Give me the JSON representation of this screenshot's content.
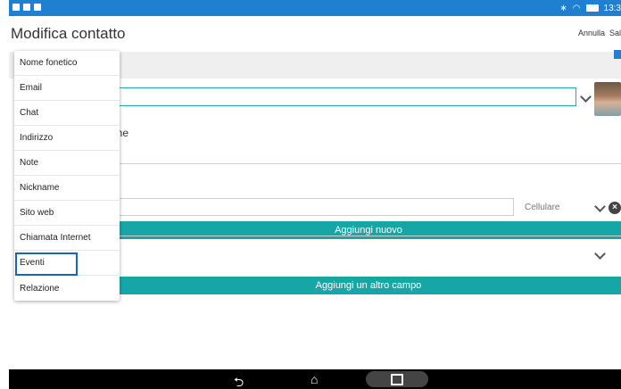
{
  "status_bar": {
    "time": "13:3",
    "left_icons": [
      "notification-icon",
      "image-icon",
      "bag-icon"
    ],
    "right_icons": [
      "bluetooth-icon",
      "wifi-icon",
      "battery-icon"
    ]
  },
  "header": {
    "title": "Modifica contatto",
    "cancel_label": "Annulla",
    "save_label": "Salv"
  },
  "form": {
    "partial_label": "one",
    "phone_type": "Cellulare",
    "add_new_label": "Aggiungi nuovo",
    "add_field_label": "Aggiungi un altro campo"
  },
  "menu": {
    "items": [
      {
        "label": "Nome fonetico"
      },
      {
        "label": "Email"
      },
      {
        "label": "Chat"
      },
      {
        "label": "Indirizzo"
      },
      {
        "label": "Note"
      },
      {
        "label": "Nickname"
      },
      {
        "label": "Sito web"
      },
      {
        "label": "Chiamata Internet"
      },
      {
        "label": "Eventi"
      },
      {
        "label": "Relazione"
      }
    ],
    "highlighted": "Eventi"
  },
  "colors": {
    "accent": "#17a6a6",
    "status_bar": "#1f7fd1",
    "highlight": "#1767b8"
  }
}
